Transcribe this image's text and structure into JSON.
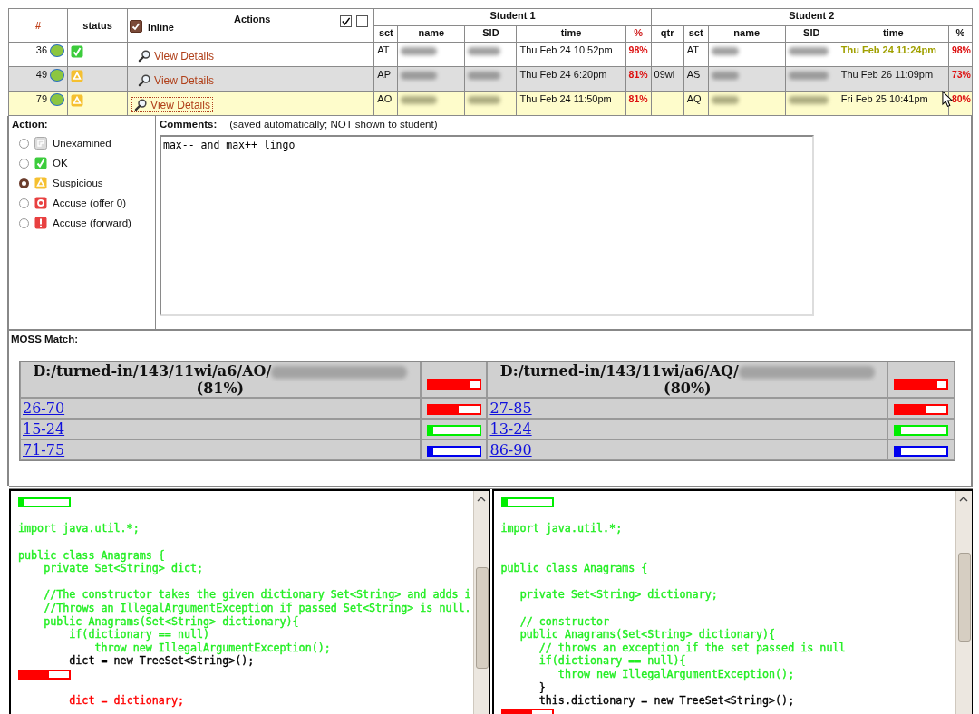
{
  "results_table": {
    "number_label": "#",
    "status_label": "status",
    "inline": {
      "label": "Inline",
      "checked": true
    },
    "actions_label": "Actions",
    "toggles": [
      {
        "checked": true
      },
      {
        "checked": false
      }
    ],
    "student1": {
      "title": "Student 1",
      "columns": [
        {
          "label": "sct",
          "accent": false
        },
        {
          "label": "name",
          "accent": false
        },
        {
          "label": "SID",
          "accent": false
        },
        {
          "label": "time",
          "accent": false
        },
        {
          "label": "%",
          "accent": true
        }
      ]
    },
    "student2": {
      "title": "Student 2",
      "columns": [
        {
          "label": "qtr",
          "accent": false
        },
        {
          "label": "sct",
          "accent": false
        },
        {
          "label": "name",
          "accent": false
        },
        {
          "label": "SID",
          "accent": false
        },
        {
          "label": "time",
          "accent": false
        },
        {
          "label": "%",
          "accent": false
        }
      ]
    },
    "rows": [
      {
        "number": "36",
        "color": "#8cc63f",
        "kind": "ok",
        "link": "View Details",
        "focused": false,
        "selected": false,
        "student1": {
          "sct": "AT",
          "time": "Thu Feb 24 10:52pm",
          "percent": "98%"
        },
        "student2": {
          "sct": "AT",
          "time": "Thu Feb 24 11:24pm",
          "time_flagged": true,
          "percent": "98%"
        }
      },
      {
        "number": "49",
        "color": "#8cc63f",
        "kind": "suspicious",
        "link": "View Details",
        "focused": false,
        "selected": false,
        "student1": {
          "sct": "AP",
          "time": "Thu Feb 24 6:20pm",
          "percent": "81%"
        },
        "student2": {
          "qtr": "09wi",
          "sct": "AS",
          "time": "Thu Feb 26 11:09pm",
          "time_flagged": false,
          "percent": "73%"
        }
      },
      {
        "number": "79",
        "color": "#8cc63f",
        "kind": "suspicious",
        "link": "View Details",
        "focused": true,
        "selected": true,
        "student1": {
          "sct": "AO",
          "time": "Thu Feb 24 11:50pm",
          "percent": "81%"
        },
        "student2": {
          "sct": "AQ",
          "time": "Fri Feb 25 10:41pm",
          "time_flagged": false,
          "percent": "80%"
        }
      }
    ]
  },
  "action_panel": {
    "title": "Action:",
    "options": [
      {
        "label": "Unexamined",
        "kind": "unexamined",
        "selected": false
      },
      {
        "label": "OK",
        "kind": "ok",
        "selected": false
      },
      {
        "label": "Suspicious",
        "kind": "suspicious",
        "selected": true
      },
      {
        "label": "Accuse (offer 0)",
        "kind": "accuse-offer",
        "selected": false
      },
      {
        "label": "Accuse (forward)",
        "kind": "accuse-forward",
        "selected": false
      }
    ]
  },
  "comments": {
    "title": "Comments:",
    "note": "(saved automatically; NOT shown to student)",
    "value": "max-- and max++ lingo"
  },
  "moss": {
    "title": "MOSS Match:",
    "files": [
      {
        "path": "D:/turned-in/143/11wi/a6/AO/",
        "percent": "(81%)",
        "color": "#ff0000",
        "level": 0.82
      },
      {
        "path": "D:/turned-in/143/11wi/a6/AQ/",
        "percent": "(80%)",
        "color": "#ff0000",
        "level": 0.82
      }
    ],
    "matches": [
      {
        "color": "#ff0000",
        "left": {
          "range": "26-70",
          "level": 0.6
        },
        "right": {
          "range": "27-85",
          "level": 0.6
        }
      },
      {
        "color": "#00ee00",
        "left": {
          "range": "15-24",
          "level": 0.1
        },
        "right": {
          "range": "13-24",
          "level": 0.1
        }
      },
      {
        "color": "#0000ee",
        "left": {
          "range": "71-75",
          "level": 0.1
        },
        "right": {
          "range": "86-90",
          "level": 0.1
        }
      }
    ]
  },
  "code_panes": [
    {
      "lines": [
        {
          "kind": "marker",
          "color": "#00ee00",
          "level": 0.1
        },
        {
          "kind": "blank"
        },
        {
          "kind": "code",
          "text": "import java.util.*;",
          "color": "#22ee22"
        },
        {
          "kind": "blank"
        },
        {
          "kind": "code",
          "text": "public class Anagrams {",
          "color": "#22ee22"
        },
        {
          "kind": "code",
          "text": "    private Set<String> dict;",
          "color": "#22ee22"
        },
        {
          "kind": "blank"
        },
        {
          "kind": "code",
          "text": "    //The constructor takes the given dictionary Set<String> and adds i",
          "color": "#22ee22"
        },
        {
          "kind": "code",
          "text": "    //Throws an IllegalArgumentException if passed Set<String> is null.",
          "color": "#22ee22"
        },
        {
          "kind": "code",
          "text": "    public Anagrams(Set<String> dictionary){",
          "color": "#22ee22"
        },
        {
          "kind": "code",
          "text": "        if(dictionary == null)",
          "color": "#22ee22"
        },
        {
          "kind": "code",
          "text": "            throw new IllegalArgumentException();",
          "color": "#22ee22"
        },
        {
          "kind": "code",
          "text": "        dict = new TreeSet<String>();",
          "color": "#000000"
        },
        {
          "kind": "marker",
          "color": "#ff0000",
          "level": 0.6
        },
        {
          "kind": "blank"
        },
        {
          "kind": "code",
          "text": "        dict = dictionary;",
          "color": "#ff0000"
        }
      ]
    },
    {
      "lines": [
        {
          "kind": "marker",
          "color": "#00ee00",
          "level": 0.1
        },
        {
          "kind": "blank"
        },
        {
          "kind": "code",
          "text": "import java.util.*;",
          "color": "#22ee22"
        },
        {
          "kind": "blank"
        },
        {
          "kind": "blank"
        },
        {
          "kind": "code",
          "text": "public class Anagrams {",
          "color": "#22ee22"
        },
        {
          "kind": "blank"
        },
        {
          "kind": "code",
          "text": "   private Set<String> dictionary;",
          "color": "#22ee22"
        },
        {
          "kind": "blank"
        },
        {
          "kind": "code",
          "text": "   // constructor",
          "color": "#22ee22"
        },
        {
          "kind": "code",
          "text": "   public Anagrams(Set<String> dictionary){",
          "color": "#22ee22"
        },
        {
          "kind": "code",
          "text": "      // throws an exception if the set passed is null",
          "color": "#22ee22"
        },
        {
          "kind": "code",
          "text": "      if(dictionary == null){",
          "color": "#22ee22"
        },
        {
          "kind": "code",
          "text": "         throw new IllegalArgumentException();",
          "color": "#22ee22"
        },
        {
          "kind": "code",
          "text": "      }",
          "color": "#000000"
        },
        {
          "kind": "code",
          "text": "      this.dictionary = new TreeSet<String>();",
          "color": "#000000"
        },
        {
          "kind": "marker",
          "color": "#ff0000",
          "level": 0.6
        }
      ]
    }
  ]
}
